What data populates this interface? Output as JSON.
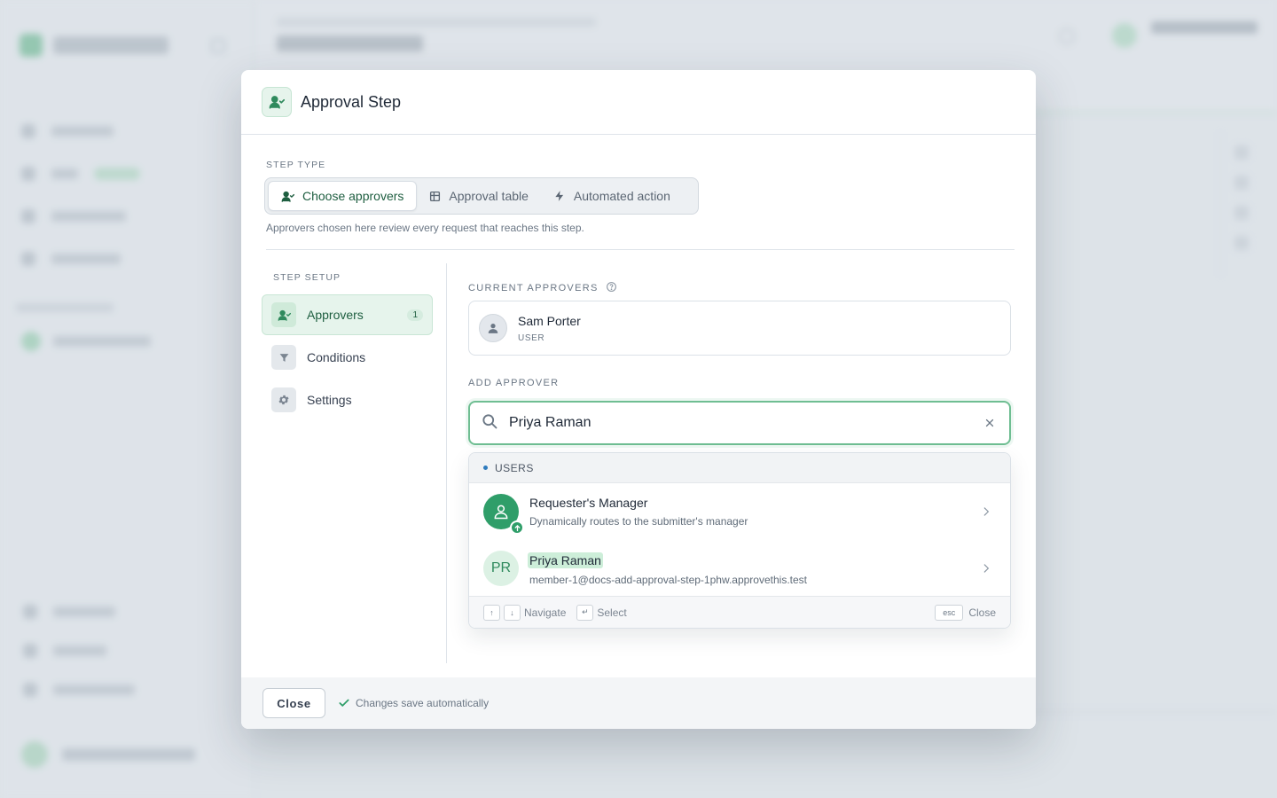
{
  "modal": {
    "title": "Approval Step",
    "step_type_label": "STEP TYPE",
    "step_types": [
      {
        "label": "Choose approvers",
        "icon": "user-check-icon",
        "active": true
      },
      {
        "label": "Approval table",
        "icon": "table-icon",
        "active": false
      },
      {
        "label": "Automated action",
        "icon": "bolt-icon",
        "active": false
      }
    ],
    "step_help": "Approvers chosen here review every request that reaches this step.",
    "setup_label": "STEP SETUP",
    "setup_items": [
      {
        "label": "Approvers",
        "icon": "user-check-icon",
        "badge": "1",
        "active": true
      },
      {
        "label": "Conditions",
        "icon": "filter-icon",
        "active": false
      },
      {
        "label": "Settings",
        "icon": "gear-icon",
        "active": false
      }
    ],
    "current_approvers_label": "CURRENT APPROVERS",
    "current_approvers": [
      {
        "name": "Sam Porter",
        "role": "USER"
      }
    ],
    "add_approver_label": "ADD APPROVER",
    "search": {
      "value": "Priya Raman"
    },
    "dropdown": {
      "group_label": "USERS",
      "results": [
        {
          "title": "Requester's Manager",
          "description": "Dynamically routes to the submitter's manager",
          "avatar": "manager-icon"
        },
        {
          "title": "Priya Raman",
          "description": "member-1@docs-add-approval-step-1phw.approvethis.test",
          "initials": "PR"
        }
      ],
      "hints": {
        "up_key": "↑",
        "down_key": "↓",
        "navigate": "Navigate",
        "enter_key": "↵",
        "select": "Select",
        "esc_key": "esc",
        "close": "Close"
      }
    },
    "footer": {
      "close_label": "Close",
      "autosave_text": "Changes save automatically"
    }
  },
  "colors": {
    "accent": "#2f9e69",
    "accent_light": "#e6f4ec",
    "focus_border": "#6fbe92"
  }
}
